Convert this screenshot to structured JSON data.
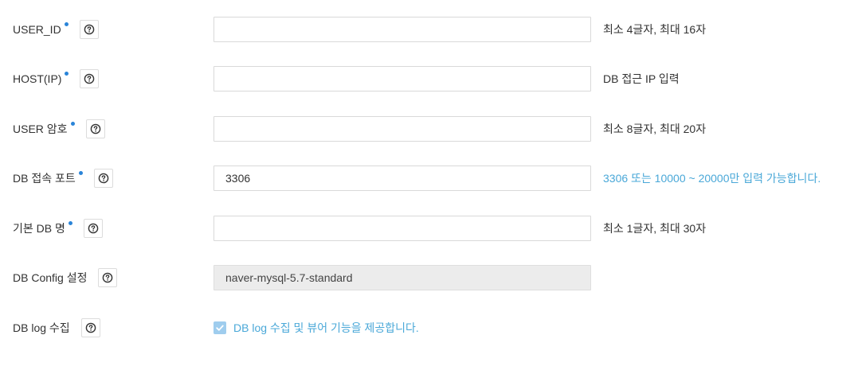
{
  "colors": {
    "required_dot": "#2a84d8",
    "hint_blue": "#4aa8d8",
    "readonly_bg": "#ececec",
    "checkbox_bg": "#9fcdee"
  },
  "fields": [
    {
      "label": "USER_ID",
      "required": true,
      "help_icon": "question-circle-icon",
      "value": "",
      "hint": "최소 4글자, 최대 16자"
    },
    {
      "label": "HOST(IP)",
      "required": true,
      "help_icon": "question-circle-icon",
      "value": "",
      "hint": "DB 접근 IP 입력"
    },
    {
      "label": "USER 암호",
      "required": true,
      "help_icon": "question-circle-icon",
      "value": "",
      "hint": "최소 8글자, 최대 20자"
    },
    {
      "label": "DB 접속 포트",
      "required": true,
      "help_icon": "question-circle-icon",
      "value": "3306",
      "hint": "3306 또는 10000 ~ 20000만 입력 가능합니다."
    },
    {
      "label": "기본 DB 명",
      "required": true,
      "help_icon": "question-circle-icon",
      "value": "",
      "hint": "최소 1글자, 최대 30자"
    },
    {
      "label": "DB Config 설정",
      "required": false,
      "help_icon": "question-circle-icon",
      "value": "naver-mysql-5.7-standard"
    },
    {
      "label": "DB log 수집",
      "required": false,
      "help_icon": "question-circle-icon",
      "checkbox_label": "DB log 수집 및 뷰어 기능을 제공합니다.",
      "checked": true
    }
  ]
}
